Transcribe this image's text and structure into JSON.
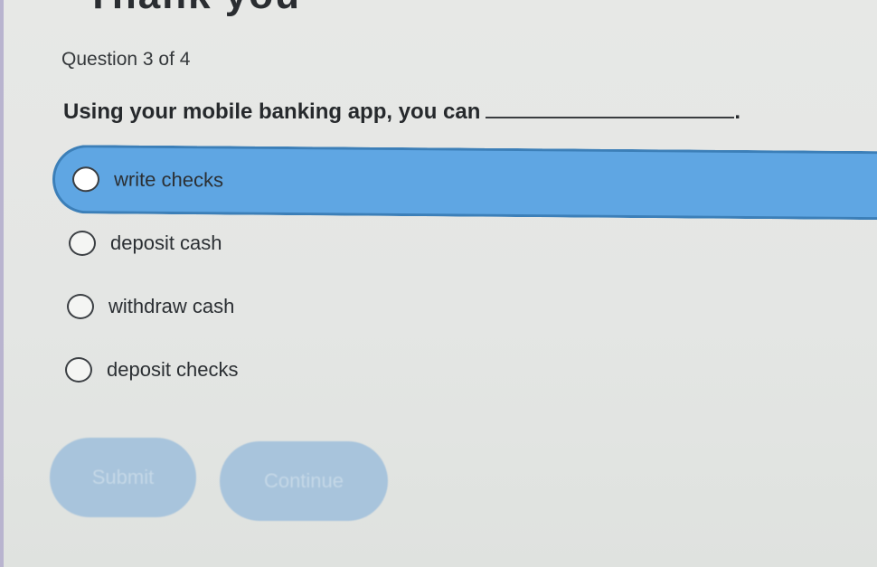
{
  "header": {
    "partial_title": "Thank you",
    "question_counter": "Question 3 of 4"
  },
  "question": {
    "text": "Using your mobile banking app, you can",
    "end_punctuation": "."
  },
  "options": [
    {
      "label": "write checks",
      "selected": true
    },
    {
      "label": "deposit cash",
      "selected": false
    },
    {
      "label": "withdraw cash",
      "selected": false
    },
    {
      "label": "deposit checks",
      "selected": false
    }
  ],
  "buttons": {
    "submit_label": "Submit",
    "continue_label": "Continue"
  },
  "colors": {
    "selected_option_fill": "#5fa6e3",
    "selected_option_border": "#3c7fb8",
    "disabled_button": "#a8c4dc"
  }
}
